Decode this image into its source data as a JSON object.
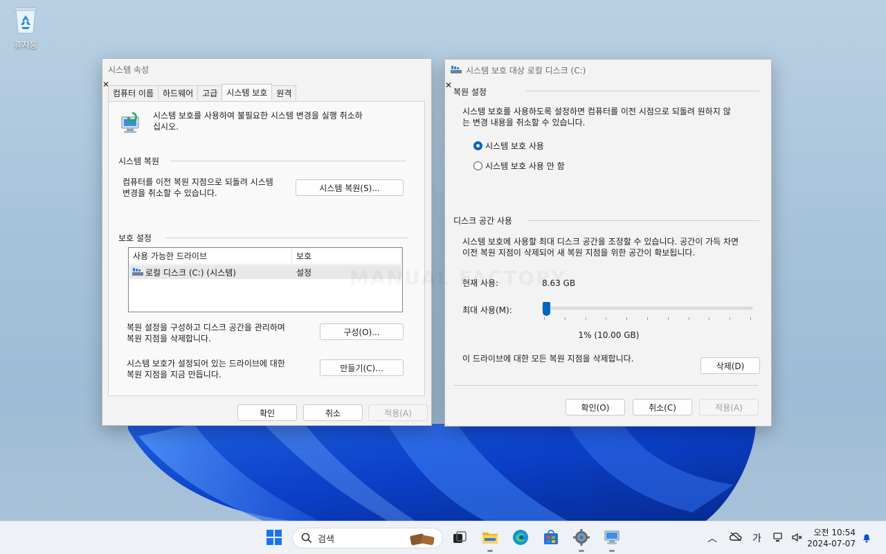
{
  "desktop": {
    "recycle_bin_label": "휴지통",
    "watermark": "MANUAL FACTORY"
  },
  "sysprops": {
    "title": "시스템 속성",
    "tabs": [
      "컴퓨터 이름",
      "하드웨어",
      "고급",
      "시스템 보호",
      "원격"
    ],
    "active_tab": 3,
    "intro": "시스템 보호를 사용하여 불필요한 시스템 변경을 실행 취소하\n십시오.",
    "restore_section": "시스템 복원",
    "restore_desc": "컴퓨터를 이전 복원 지점으로 되돌려 시스템\n변경을 취소할 수 있습니다.",
    "restore_button": "시스템 복원(S)...",
    "protection_section": "보호 설정",
    "drives_header": "사용 가능한 드라이브",
    "protection_header": "보호",
    "drive_row": {
      "name": "로컬 디스크 (C:) (시스템)",
      "protection": "설정"
    },
    "configure_desc": "복원 설정을 구성하고 디스크 공간을 관리하며\n복원 지점을 삭제합니다.",
    "configure_button": "구성(O)...",
    "create_desc": "시스템 보호가 설정되어 있는 드라이브에 대한\n복원 지점을 지금 만듭니다.",
    "create_button": "만들기(C)...",
    "ok": "확인",
    "cancel": "취소",
    "apply": "적용(A)"
  },
  "protect": {
    "title": "시스템 보호 대상 로컬 디스크 (C:)",
    "restore_settings": "복원 설정",
    "restore_desc": "시스템 보호를 사용하도록 설정하면 컴퓨터를 이전 시점으로 되돌려 원하지 않\n는 변경 내용을 취소할 수 있습니다.",
    "radio_on": "시스템 보호 사용",
    "radio_off": "시스템 보호 사용 안 함",
    "disk_usage": "디스크 공간 사용",
    "disk_desc": "시스템 보호에 사용할 최대 디스크 공간을 조정할 수 있습니다. 공간이 가득 차면\n이전 복원 지점이 삭제되어 새 복원 지점을 위한 공간이 확보됩니다.",
    "current_label": "현재 사용:",
    "current_value": "8.63 GB",
    "max_label": "최대 사용(M):",
    "slider_percent": 1,
    "slider_readout": "1% (10.00 GB)",
    "delete_desc": "이 드라이브에 대한 모든 복원 지점을 삭제합니다.",
    "delete_button": "삭제(D)",
    "ok": "확인(O)",
    "cancel": "취소(C)",
    "apply": "적용(A)"
  },
  "taskbar": {
    "search_placeholder": "검색",
    "ime": "가",
    "time": "오전 10:54",
    "date": "2024-07-07"
  },
  "colors": {
    "accent": "#0067c0"
  }
}
